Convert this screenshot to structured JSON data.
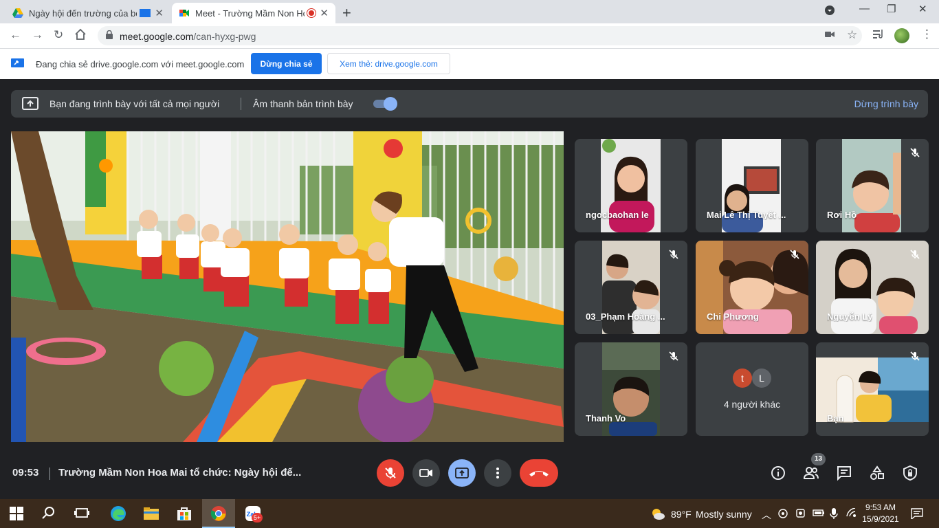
{
  "browser": {
    "tabs": [
      {
        "title": "Ngày hội đến trường của bé",
        "active": false,
        "icon": "google-drive-icon"
      },
      {
        "title": "Meet - Trường Mầm Non Hoa",
        "active": true,
        "icon": "google-meet-icon"
      }
    ],
    "url_host": "meet.google.com",
    "url_path": "/can-hyxg-pwg"
  },
  "share_notice": {
    "text": "Đang chia sẻ drive.google.com với meet.google.com",
    "stop_button": "Dừng chia sẻ",
    "view_button": "Xem thẻ: drive.google.com"
  },
  "presenting_bar": {
    "message": "Bạn đang trình bày với tất cả mọi người",
    "audio_label": "Âm thanh bản trình bày",
    "audio_on": true,
    "stop_label": "Dừng trình bày"
  },
  "participants": [
    {
      "name": "ngocbaohan le",
      "muted": false
    },
    {
      "name": "Mai Lê Thị Tuyết ...",
      "muted": false
    },
    {
      "name": "Rơi Hồ",
      "muted": true
    },
    {
      "name": "03_Phạm Hoàng ...",
      "muted": true
    },
    {
      "name": "Chi Phương",
      "muted": true
    },
    {
      "name": "Nguyễn Lý",
      "muted": true
    },
    {
      "name": "Thanh Vo",
      "muted": true
    },
    {
      "name": "4 người khác",
      "muted": false,
      "others": [
        "t",
        "L"
      ]
    },
    {
      "name": "Bạn",
      "muted": true
    }
  ],
  "bottom": {
    "time": "09:53",
    "meeting_title": "Trường Mầm Non Hoa Mai tổ chức: Ngày hội đế...",
    "people_count": "13"
  },
  "taskbar": {
    "temperature": "89°F",
    "weather": "Mostly sunny",
    "time": "9:53 AM",
    "date": "15/9/2021",
    "zalo_badge": "5+"
  },
  "colors": {
    "accent": "#1a73e8",
    "hangup": "#ea4335",
    "present_blue": "#8ab4f8"
  }
}
